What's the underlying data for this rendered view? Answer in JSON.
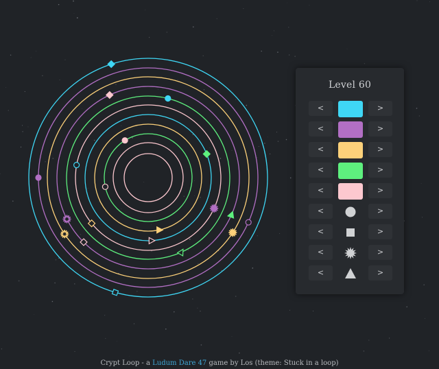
{
  "level": {
    "title": "Level 60"
  },
  "controls": {
    "prev_label": "<",
    "next_label": ">"
  },
  "colors": {
    "background": "#202327",
    "cyan": "#3fd7f5",
    "purple": "#b26fc4",
    "yellow": "#fdd17a",
    "green": "#5ef07e",
    "pink": "#fdc8cf",
    "shape": "#d0d2d4"
  },
  "color_rows": [
    {
      "name": "cyan",
      "color": "#3fd7f5"
    },
    {
      "name": "purple",
      "color": "#b26fc4"
    },
    {
      "name": "yellow",
      "color": "#fdd17a"
    },
    {
      "name": "green",
      "color": "#5ef07e"
    },
    {
      "name": "pink",
      "color": "#fdc8cf"
    }
  ],
  "shape_rows": [
    {
      "name": "circle-icon"
    },
    {
      "name": "square-icon"
    },
    {
      "name": "star-icon"
    },
    {
      "name": "triangle-icon"
    }
  ],
  "rings": [
    {
      "color": "cyan"
    },
    {
      "color": "purple"
    },
    {
      "color": "yellow"
    },
    {
      "color": "purple"
    },
    {
      "color": "green"
    },
    {
      "color": "pink"
    },
    {
      "color": "cyan"
    },
    {
      "color": "yellow"
    },
    {
      "color": "green"
    },
    {
      "color": "pink"
    }
  ],
  "footer": {
    "prefix": "Crypt Loop - a ",
    "link": "Ludum Dare 47",
    "suffix": " game by Los (theme: Stuck in a loop)"
  }
}
